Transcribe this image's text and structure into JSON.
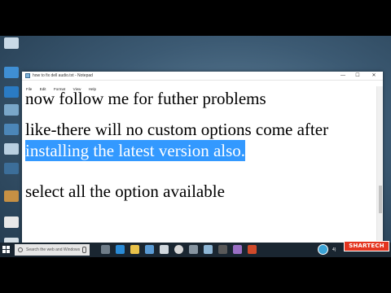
{
  "notepad": {
    "title": "how to fix dell audio.txt - Notepad",
    "menu": [
      "File",
      "Edit",
      "Format",
      "View",
      "Help"
    ],
    "lines": [
      "now follow me for futher problems",
      "like-there will no custom options come after",
      "installing the latest version also.",
      "select all the option available"
    ],
    "window_buttons": {
      "minimize": "—",
      "maximize": "☐",
      "close": "✕"
    }
  },
  "taskbar": {
    "search_placeholder": "Search the web and Windows",
    "apps": [
      "task-view-icon",
      "edge-icon",
      "file-explorer-icon",
      "store-icon",
      "mail-icon",
      "chrome-icon",
      "settings-icon",
      "notepad-icon",
      "camera-icon",
      "photos-icon",
      "media-icon"
    ],
    "tray_text": "4)"
  },
  "watermark": {
    "text": "SHARTECH"
  },
  "colors": {
    "selection": "#3399ff",
    "taskbar": "#1a2631",
    "brand": "#e4341f"
  }
}
